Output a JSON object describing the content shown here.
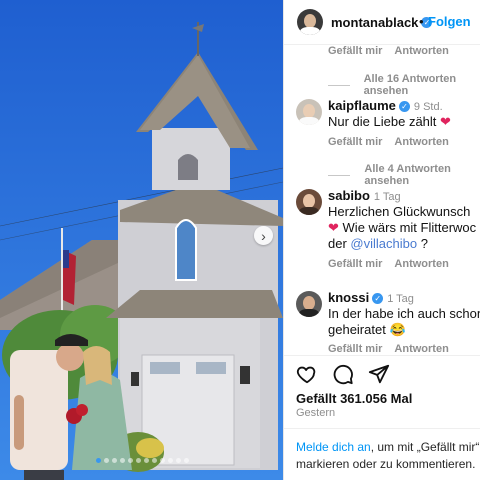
{
  "header": {
    "username": "montanablack",
    "follow_separator": "•",
    "follow_label": "Folgen"
  },
  "comments": [
    {
      "meta": {
        "like": "Gefällt mir",
        "reply": "Antworten"
      },
      "thread": "Alle 16 Antworten ansehen"
    },
    {
      "username": "kaipflaume",
      "time": "9 Std.",
      "text": "Nur die Liebe zählt",
      "emoji": "❤",
      "meta": {
        "like": "Gefällt mir",
        "reply": "Antworten"
      },
      "thread": "Alle 4 Antworten ansehen"
    },
    {
      "username": "sabibo",
      "time": "1 Tag",
      "line1": "Herzlichen Glückwunsch",
      "line2": "Wie wärs mit Flitterwoc",
      "line3_prefix": "der",
      "mention": "@villachibo",
      "line3_suffix": "?",
      "emoji": "❤",
      "meta": {
        "like": "Gefällt mir",
        "reply": "Antworten"
      }
    },
    {
      "username": "knossi",
      "time": "1 Tag",
      "line1": "In der habe ich auch schon",
      "line2": "geheiratet",
      "emoji": "😂",
      "meta": {
        "like": "Gefällt mir",
        "reply": "Antworten"
      }
    }
  ],
  "actions": {
    "icons": [
      "heart-icon",
      "comment-icon",
      "share-icon"
    ]
  },
  "likes": "Gefällt 361.056 Mal",
  "date": "Gestern",
  "login": {
    "link": "Melde dich an",
    "text1": ", um mit „Gefällt mir“ z",
    "text2": "markieren oder zu kommentieren."
  },
  "carousel": {
    "slides": 12,
    "active": 0,
    "next_icon": "chevron-right-icon"
  },
  "colors": {
    "accent": "#0095f6",
    "verified": "#3897f0",
    "heart": "#e0245e",
    "sky": "#2a6ed4"
  }
}
